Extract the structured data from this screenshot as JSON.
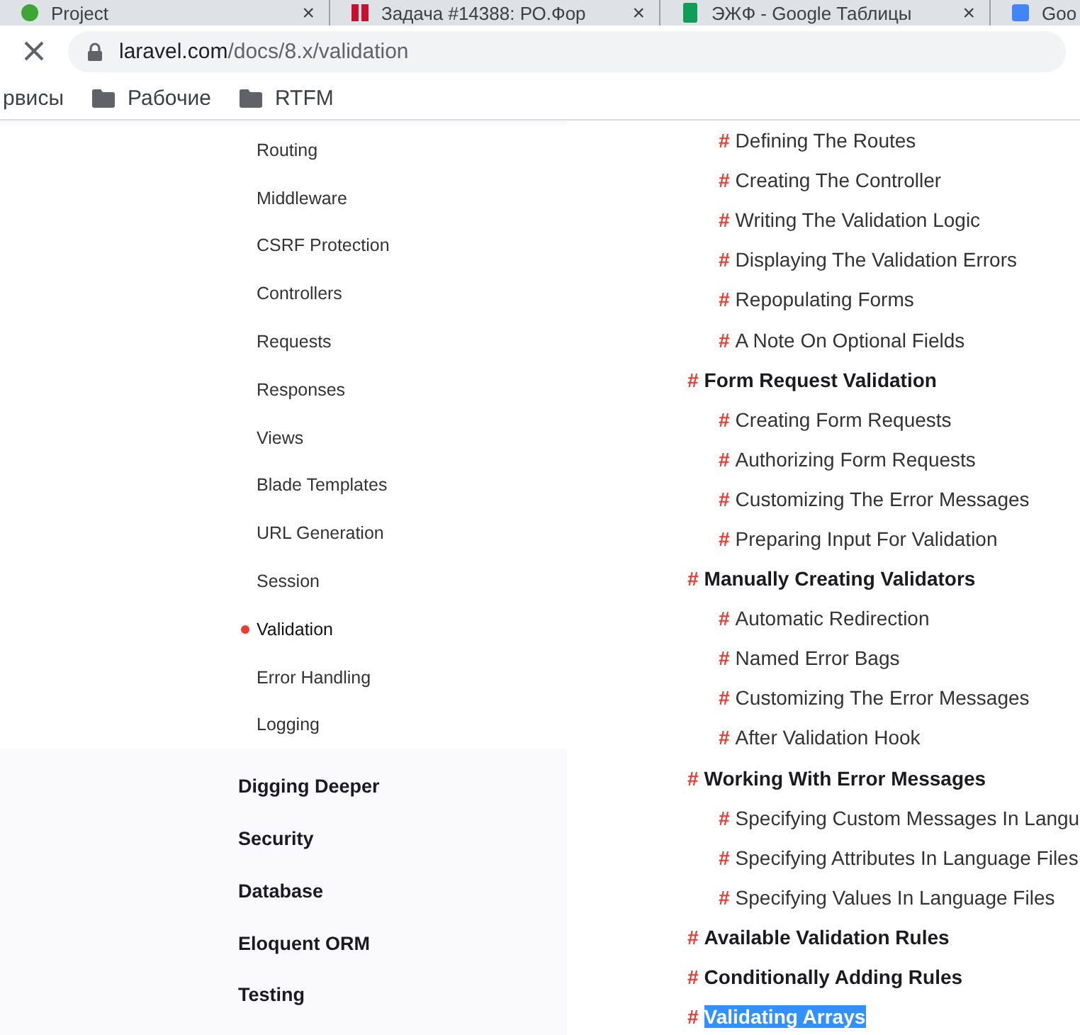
{
  "tabs": [
    {
      "label": "Project",
      "kind": "leaf",
      "close": "×"
    },
    {
      "label": "Задача #14388: РО.Фор",
      "kind": "tracker",
      "close": "×"
    },
    {
      "label": "ЭЖФ - Google Таблицы",
      "kind": "sheet",
      "close": "×"
    },
    {
      "label": "Goo",
      "kind": "doc"
    }
  ],
  "address_bar": {
    "domain": "laravel.com",
    "path": "/docs/8.x/validation"
  },
  "bookmarks": [
    {
      "label": "рвисы",
      "kind": "plain"
    },
    {
      "label": "Рабочие",
      "kind": "folder"
    },
    {
      "label": "RTFM",
      "kind": "folder"
    }
  ],
  "sidebar": {
    "items": [
      {
        "label": "Routing",
        "kind": "page",
        "selected": false
      },
      {
        "label": "Middleware",
        "kind": "page",
        "selected": false
      },
      {
        "label": "CSRF Protection",
        "kind": "page",
        "selected": false
      },
      {
        "label": "Controllers",
        "kind": "page",
        "selected": false
      },
      {
        "label": "Requests",
        "kind": "page",
        "selected": false
      },
      {
        "label": "Responses",
        "kind": "page",
        "selected": false
      },
      {
        "label": "Views",
        "kind": "page",
        "selected": false
      },
      {
        "label": "Blade Templates",
        "kind": "page",
        "selected": false
      },
      {
        "label": "URL Generation",
        "kind": "page",
        "selected": false
      },
      {
        "label": "Session",
        "kind": "page",
        "selected": false
      },
      {
        "label": "Validation",
        "kind": "page",
        "selected": true
      },
      {
        "label": "Error Handling",
        "kind": "page",
        "selected": false
      },
      {
        "label": "Logging",
        "kind": "page",
        "selected": false
      },
      {
        "label": "Digging Deeper",
        "kind": "section"
      },
      {
        "label": "Security",
        "kind": "section"
      },
      {
        "label": "Database",
        "kind": "section"
      },
      {
        "label": "Eloquent ORM",
        "kind": "section"
      },
      {
        "label": "Testing",
        "kind": "section"
      }
    ]
  },
  "contents": [
    {
      "hash": "#",
      "label": "Defining The Routes",
      "kind": "sub",
      "highlighted": false
    },
    {
      "hash": "#",
      "label": "Creating The Controller",
      "kind": "sub",
      "highlighted": false
    },
    {
      "hash": "#",
      "label": "Writing The Validation Logic",
      "kind": "sub",
      "highlighted": false
    },
    {
      "hash": "#",
      "label": "Displaying The Validation Errors",
      "kind": "sub",
      "highlighted": false
    },
    {
      "hash": "#",
      "label": "Repopulating Forms",
      "kind": "sub",
      "highlighted": false
    },
    {
      "hash": "#",
      "label": "A Note On Optional Fields",
      "kind": "sub",
      "highlighted": false
    },
    {
      "hash": "#",
      "label": "Form Request Validation",
      "kind": "section",
      "highlighted": false
    },
    {
      "hash": "#",
      "label": "Creating Form Requests",
      "kind": "sub",
      "highlighted": false
    },
    {
      "hash": "#",
      "label": "Authorizing Form Requests",
      "kind": "sub",
      "highlighted": false
    },
    {
      "hash": "#",
      "label": "Customizing The Error Messages",
      "kind": "sub",
      "highlighted": false
    },
    {
      "hash": "#",
      "label": "Preparing Input For Validation",
      "kind": "sub",
      "highlighted": false
    },
    {
      "hash": "#",
      "label": "Manually Creating Validators",
      "kind": "section",
      "highlighted": false
    },
    {
      "hash": "#",
      "label": "Automatic Redirection",
      "kind": "sub",
      "highlighted": false
    },
    {
      "hash": "#",
      "label": "Named Error Bags",
      "kind": "sub",
      "highlighted": false
    },
    {
      "hash": "#",
      "label": "Customizing The Error Messages",
      "kind": "sub",
      "highlighted": false
    },
    {
      "hash": "#",
      "label": "After Validation Hook",
      "kind": "sub",
      "highlighted": false
    },
    {
      "hash": "#",
      "label": "Working With Error Messages",
      "kind": "section",
      "highlighted": false
    },
    {
      "hash": "#",
      "label": "Specifying Custom Messages In Langu",
      "kind": "sub",
      "highlighted": false
    },
    {
      "hash": "#",
      "label": "Specifying Attributes In Language Files",
      "kind": "sub",
      "highlighted": false
    },
    {
      "hash": "#",
      "label": "Specifying Values In Language Files",
      "kind": "sub",
      "highlighted": false
    },
    {
      "hash": "#",
      "label": "Available Validation Rules",
      "kind": "section",
      "highlighted": false
    },
    {
      "hash": "#",
      "label": "Conditionally Adding Rules",
      "kind": "section",
      "highlighted": false
    },
    {
      "hash": "#",
      "label": "Validating Arrays",
      "kind": "section",
      "highlighted": true
    }
  ]
}
